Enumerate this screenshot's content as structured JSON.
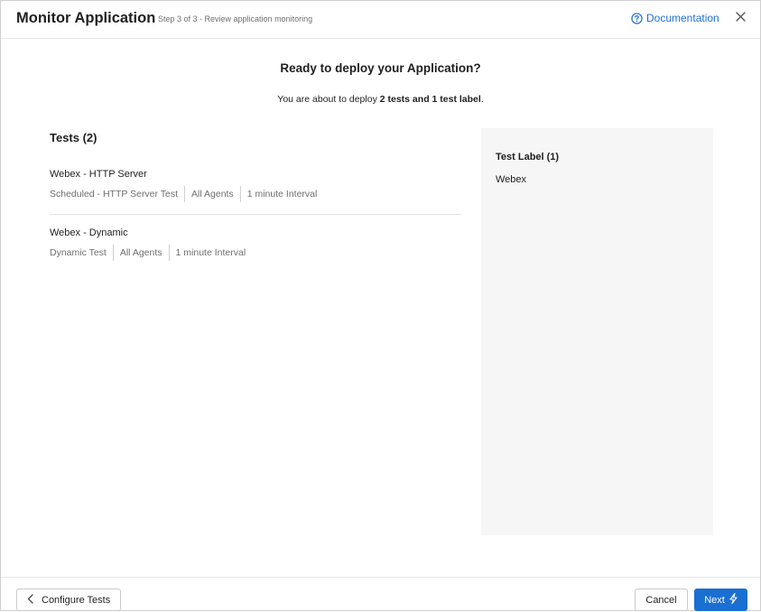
{
  "header": {
    "title": "Monitor Application",
    "step": "Step 3 of 3 - Review application monitoring",
    "documentation_label": "Documentation",
    "documentation_icon": "help-circle-icon",
    "close_icon": "close-icon"
  },
  "main": {
    "heading": "Ready to deploy your Application?",
    "summary": {
      "prefix": "You are about to deploy ",
      "bold": "2 tests and 1 test label",
      "suffix": "."
    },
    "tests_title": "Tests (2)",
    "tests": [
      {
        "name": "Webex - HTTP Server",
        "type": "Scheduled - HTTP Server Test",
        "agents": "All Agents",
        "interval": "1 minute Interval"
      },
      {
        "name": "Webex - Dynamic",
        "type": "Dynamic Test",
        "agents": "All Agents",
        "interval": "1 minute Interval"
      }
    ],
    "label_panel": {
      "title": "Test Label (1)",
      "labels": [
        "Webex"
      ]
    }
  },
  "footer": {
    "back_label": "Configure Tests",
    "cancel_label": "Cancel",
    "next_label": "Next",
    "next_icon": "lightning-icon"
  },
  "colors": {
    "accent": "#1a6fd3",
    "link": "#1f6fd6",
    "panel_bg": "#f6f6f6",
    "muted_text": "#6e6e6e"
  }
}
